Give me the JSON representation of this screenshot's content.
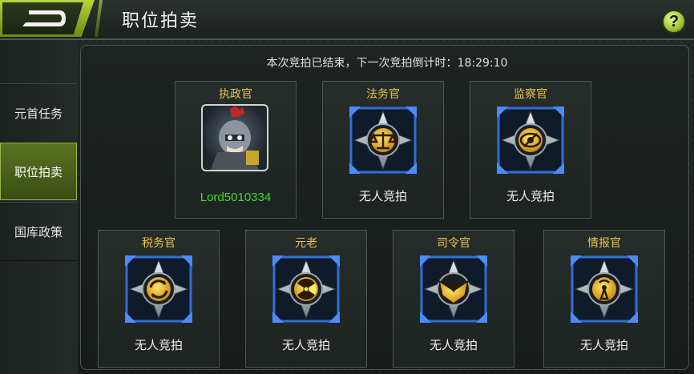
{
  "header": {
    "title": "职位拍卖",
    "back_icon": "back-arrow-icon",
    "help_label": "?"
  },
  "sidebar": {
    "items": [
      {
        "label": "元首任务",
        "active": false
      },
      {
        "label": "职位拍卖",
        "active": true
      },
      {
        "label": "国库政策",
        "active": false
      }
    ]
  },
  "auction": {
    "countdown_text": "本次竞拍已结束，下一次竞拍倒计时：18:29:10"
  },
  "positions": [
    {
      "name": "执政官",
      "holder": "Lord5010334",
      "icon": "commander-portrait"
    },
    {
      "name": "法务官",
      "status": "无人竞拍",
      "icon": "scales-icon"
    },
    {
      "name": "监察官",
      "status": "无人竞拍",
      "icon": "eye-icon"
    },
    {
      "name": "税务官",
      "status": "无人竞拍",
      "icon": "exchange-icon"
    },
    {
      "name": "元老",
      "status": "无人竞拍",
      "icon": "radiation-icon"
    },
    {
      "name": "司令官",
      "status": "无人竞拍",
      "icon": "eagle-icon"
    },
    {
      "name": "情报官",
      "status": "无人竞拍",
      "icon": "signal-icon"
    }
  ],
  "colors": {
    "accent_green": "#9bc23a",
    "title_gold": "#e7c34a",
    "holder_green": "#3fdc2a",
    "emblem_blue": "#2f6fd6"
  }
}
